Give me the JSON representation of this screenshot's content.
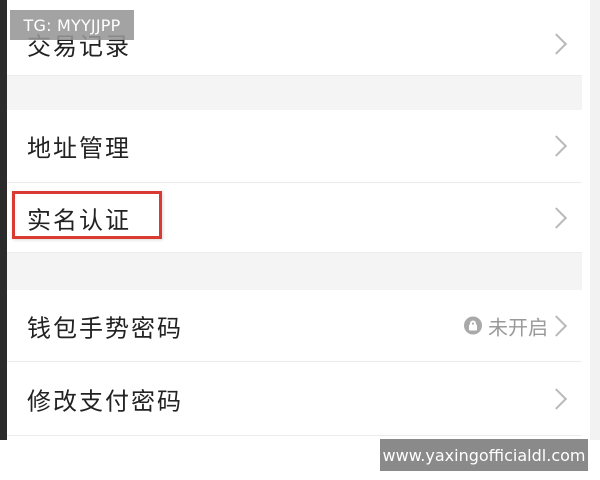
{
  "watermarks": {
    "top_left": "TG: MYYJJPP",
    "bottom_right": "www.yaxingofficialdl.com"
  },
  "settings_list": {
    "items": [
      {
        "label": "交易记录",
        "icon": "chevron-right-icon"
      },
      {
        "label": "地址管理",
        "icon": "chevron-right-icon"
      },
      {
        "label": "实名认证",
        "icon": "chevron-right-icon",
        "highlighted": true
      },
      {
        "label": "钱包手势密码",
        "status": "未开启",
        "status_icon": "lock-icon",
        "icon": "chevron-right-icon"
      },
      {
        "label": "修改支付密码",
        "icon": "chevron-right-icon"
      }
    ]
  },
  "colors": {
    "highlight_border": "#d93a32",
    "section_gap": "#f4f4f4",
    "text": "#222222",
    "status_text": "#999999"
  }
}
